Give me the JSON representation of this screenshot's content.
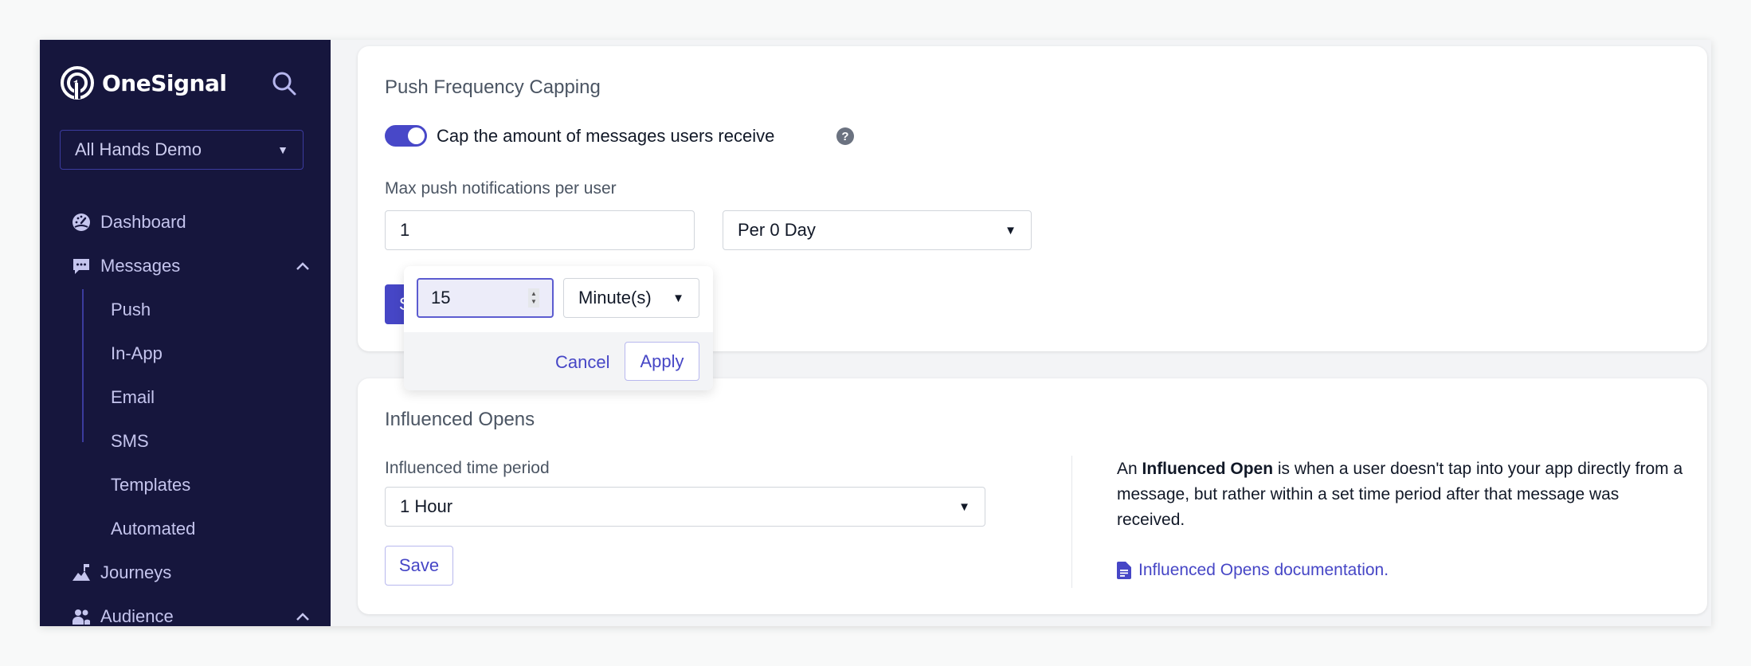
{
  "sidebar": {
    "brand": "OneSignal",
    "app_selector": "All Hands Demo",
    "nav": [
      {
        "label": "Dashboard",
        "icon": "dashboard-gauge-icon"
      },
      {
        "label": "Messages",
        "icon": "messages-chat-icon",
        "expanded": true
      },
      {
        "label": "Journeys",
        "icon": "journeys-flag-icon"
      },
      {
        "label": "Audience",
        "icon": "audience-people-icon",
        "expanded": true
      }
    ],
    "messages_sub": [
      "Push",
      "In-App",
      "Email",
      "SMS",
      "Templates",
      "Automated"
    ]
  },
  "frequency_capping": {
    "title": "Push Frequency Capping",
    "toggle_label": "Cap the amount of messages users receive",
    "toggle_on": true,
    "help": "?",
    "max_label": "Max push notifications per user",
    "max_value": "1",
    "period_select": "Per 0 Day",
    "save": "Save",
    "popover": {
      "amount": "15",
      "unit": "Minute(s)",
      "cancel": "Cancel",
      "apply": "Apply"
    }
  },
  "influenced_opens": {
    "title": "Influenced Opens",
    "period_label": "Influenced time period",
    "period_value": "1 Hour",
    "save": "Save",
    "desc_prefix": "An ",
    "desc_bold": "Influenced Open",
    "desc_rest": " is when a user doesn't tap into your app directly from a message, but rather within a set time period after that message was received.",
    "doc_link": "Influenced Opens documentation."
  },
  "colors": {
    "sidebar_bg": "#16163d",
    "accent": "#4646c6",
    "page_bg": "#f3f4f6"
  }
}
